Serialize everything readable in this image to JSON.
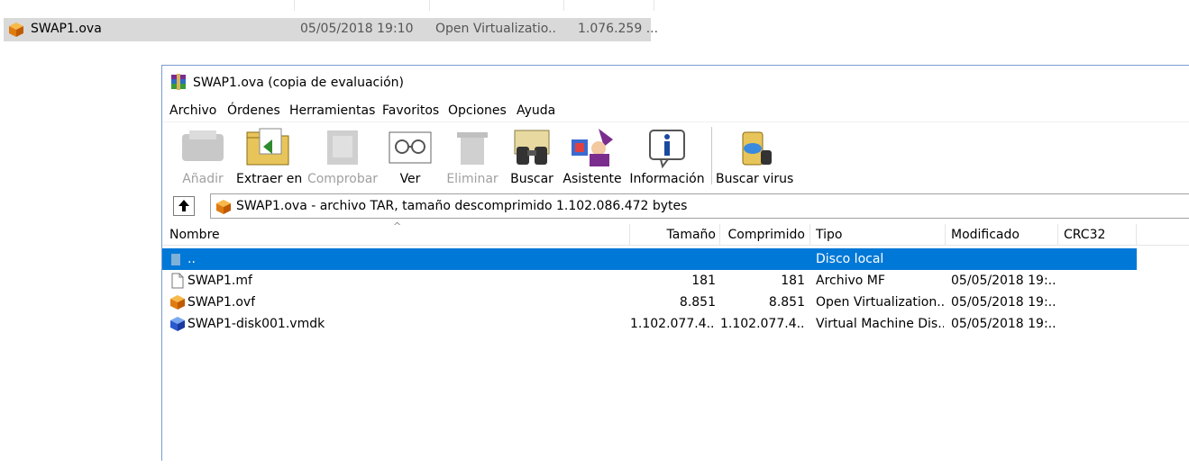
{
  "explorer": {
    "file": {
      "name": "SWAP1.ova",
      "modified": "05/05/2018 19:10",
      "type": "Open Virtualizatio...",
      "size": "1.076.259 ..."
    }
  },
  "window": {
    "title": "SWAP1.ova (copia de evaluación)"
  },
  "menu": [
    "Archivo",
    "Órdenes",
    "Herramientas",
    "Favoritos",
    "Opciones",
    "Ayuda"
  ],
  "toolbar": {
    "add": "Añadir",
    "extract": "Extraer en",
    "test": "Comprobar",
    "view": "Ver",
    "delete": "Eliminar",
    "find": "Buscar",
    "wizard": "Asistente",
    "info": "Información",
    "virus": "Buscar virus"
  },
  "address": {
    "text": "SWAP1.ova - archivo TAR, tamaño descomprimido 1.102.086.472 bytes"
  },
  "list": {
    "headers": {
      "name": "Nombre",
      "size": "Tamaño",
      "packed": "Comprimido",
      "type": "Tipo",
      "modified": "Modificado",
      "crc": "CRC32"
    },
    "parent": {
      "name": "..",
      "type": "Disco local"
    },
    "rows": [
      {
        "name": "SWAP1.mf",
        "size": "181",
        "packed": "181",
        "type": "Archivo MF",
        "modified": "05/05/2018 19:..."
      },
      {
        "name": "SWAP1.ovf",
        "size": "8.851",
        "packed": "8.851",
        "type": "Open Virtualization...",
        "modified": "05/05/2018 19:..."
      },
      {
        "name": "SWAP1-disk001.vmdk",
        "size": "1.102.077.4...",
        "packed": "1.102.077.4...",
        "type": "Virtual Machine Dis...",
        "modified": "05/05/2018 19:..."
      }
    ]
  },
  "colors": {
    "selection": "#0078d7",
    "disabled_text": "#a0a0a0",
    "explorer_selection": "#d9d9d9"
  },
  "icons": {
    "ova": "orange-box-icon",
    "vmdk": "blue-box-icon",
    "mf": "text-file-icon",
    "app": "winrar-icon"
  }
}
